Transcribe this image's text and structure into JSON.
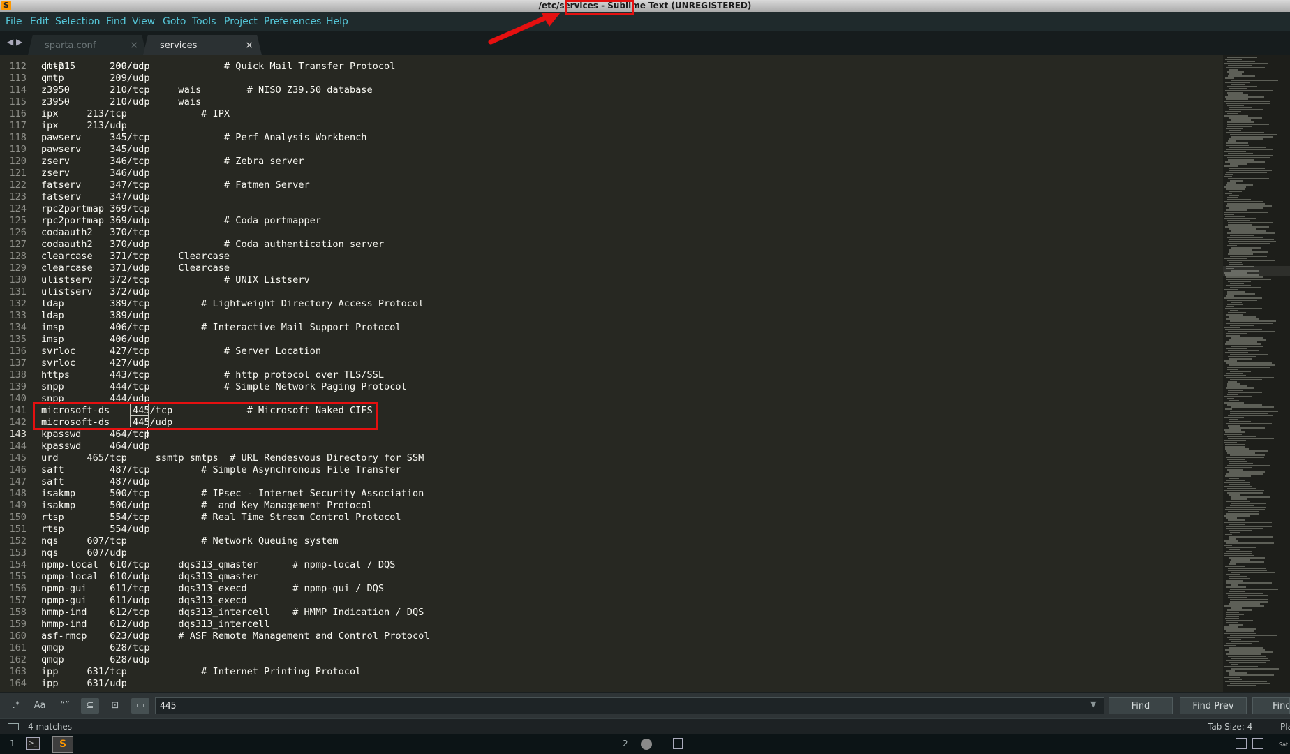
{
  "window": {
    "title": "/etc/services - Sublime Text (UNREGISTERED)",
    "logo": "S"
  },
  "menu": [
    "File",
    "Edit",
    "Selection",
    "Find",
    "View",
    "Goto",
    "Tools",
    "Project",
    "Preferences",
    "Help"
  ],
  "tabs": [
    {
      "label": "sparta.conf",
      "close": "×",
      "active": false
    },
    {
      "label": "services",
      "close": "×",
      "active": true
    }
  ],
  "tab_nav": "◀ ▶",
  "editor": {
    "partial_line": "dt-215      200/udp",
    "lines": [
      {
        "n": "112",
        "t": "qmtp        209/tcp             # Quick Mail Transfer Protocol"
      },
      {
        "n": "113",
        "t": "qmtp        209/udp"
      },
      {
        "n": "114",
        "t": "z3950       210/tcp     wais        # NISO Z39.50 database"
      },
      {
        "n": "115",
        "t": "z3950       210/udp     wais"
      },
      {
        "n": "116",
        "t": "ipx     213/tcp             # IPX"
      },
      {
        "n": "117",
        "t": "ipx     213/udp"
      },
      {
        "n": "118",
        "t": "pawserv     345/tcp             # Perf Analysis Workbench"
      },
      {
        "n": "119",
        "t": "pawserv     345/udp"
      },
      {
        "n": "120",
        "t": "zserv       346/tcp             # Zebra server"
      },
      {
        "n": "121",
        "t": "zserv       346/udp"
      },
      {
        "n": "122",
        "t": "fatserv     347/tcp             # Fatmen Server"
      },
      {
        "n": "123",
        "t": "fatserv     347/udp"
      },
      {
        "n": "124",
        "t": "rpc2portmap 369/tcp"
      },
      {
        "n": "125",
        "t": "rpc2portmap 369/udp             # Coda portmapper"
      },
      {
        "n": "126",
        "t": "codaauth2   370/tcp"
      },
      {
        "n": "127",
        "t": "codaauth2   370/udp             # Coda authentication server"
      },
      {
        "n": "128",
        "t": "clearcase   371/tcp     Clearcase"
      },
      {
        "n": "129",
        "t": "clearcase   371/udp     Clearcase"
      },
      {
        "n": "130",
        "t": "ulistserv   372/tcp             # UNIX Listserv"
      },
      {
        "n": "131",
        "t": "ulistserv   372/udp"
      },
      {
        "n": "132",
        "t": "ldap        389/tcp         # Lightweight Directory Access Protocol"
      },
      {
        "n": "133",
        "t": "ldap        389/udp"
      },
      {
        "n": "134",
        "t": "imsp        406/tcp         # Interactive Mail Support Protocol"
      },
      {
        "n": "135",
        "t": "imsp        406/udp"
      },
      {
        "n": "136",
        "t": "svrloc      427/tcp             # Server Location"
      },
      {
        "n": "137",
        "t": "svrloc      427/udp"
      },
      {
        "n": "138",
        "t": "https       443/tcp             # http protocol over TLS/SSL"
      },
      {
        "n": "139",
        "t": "snpp        444/tcp             # Simple Network Paging Protocol"
      },
      {
        "n": "140",
        "t": "snpp        444/udp"
      },
      {
        "n": "141",
        "t": "microsoft-ds    445/tcp             # Microsoft Naked CIFS"
      },
      {
        "n": "142",
        "t": "microsoft-ds    445/udp"
      },
      {
        "n": "143",
        "t": "kpasswd     464/tcp"
      },
      {
        "n": "144",
        "t": "kpasswd     464/udp"
      },
      {
        "n": "145",
        "t": "urd     465/tcp     ssmtp smtps  # URL Rendesvous Directory for SSM"
      },
      {
        "n": "146",
        "t": "saft        487/tcp         # Simple Asynchronous File Transfer"
      },
      {
        "n": "147",
        "t": "saft        487/udp"
      },
      {
        "n": "148",
        "t": "isakmp      500/tcp         # IPsec - Internet Security Association"
      },
      {
        "n": "149",
        "t": "isakmp      500/udp         #  and Key Management Protocol"
      },
      {
        "n": "150",
        "t": "rtsp        554/tcp         # Real Time Stream Control Protocol"
      },
      {
        "n": "151",
        "t": "rtsp        554/udp"
      },
      {
        "n": "152",
        "t": "nqs     607/tcp             # Network Queuing system"
      },
      {
        "n": "153",
        "t": "nqs     607/udp"
      },
      {
        "n": "154",
        "t": "npmp-local  610/tcp     dqs313_qmaster      # npmp-local / DQS"
      },
      {
        "n": "155",
        "t": "npmp-local  610/udp     dqs313_qmaster"
      },
      {
        "n": "156",
        "t": "npmp-gui    611/tcp     dqs313_execd        # npmp-gui / DQS"
      },
      {
        "n": "157",
        "t": "npmp-gui    611/udp     dqs313_execd"
      },
      {
        "n": "158",
        "t": "hmmp-ind    612/tcp     dqs313_intercell    # HMMP Indication / DQS"
      },
      {
        "n": "159",
        "t": "hmmp-ind    612/udp     dqs313_intercell"
      },
      {
        "n": "160",
        "t": "asf-rmcp    623/udp     # ASF Remote Management and Control Protocol"
      },
      {
        "n": "161",
        "t": "qmqp        628/tcp"
      },
      {
        "n": "162",
        "t": "qmqp        628/udp"
      },
      {
        "n": "163",
        "t": "ipp     631/tcp             # Internet Printing Protocol"
      },
      {
        "n": "164",
        "t": "ipp     631/udp"
      }
    ],
    "current_line": "143"
  },
  "find": {
    "options": [
      ".*",
      "Aa",
      "“”",
      "⊆",
      "⊡",
      "▭"
    ],
    "value": "445",
    "dropdown": "▼",
    "buttons": [
      "Find",
      "Find Prev",
      "Find All"
    ]
  },
  "status": {
    "text": "4 matches",
    "tab_size": "Tab Size: 4",
    "syntax": "Plain Text"
  },
  "taskbar": {
    "ws1": "1",
    "ws2": "2",
    "clock": "Sat"
  },
  "colors": {
    "annotation": "#e51010",
    "editor_bg": "#272822",
    "menu_text": "#55c6d8"
  },
  "icons": [
    "app-logo-icon",
    "status-panel-icon",
    "terminal-icon",
    "sublime-icon",
    "firefox-icon",
    "file-icon",
    "tray-icon"
  ]
}
